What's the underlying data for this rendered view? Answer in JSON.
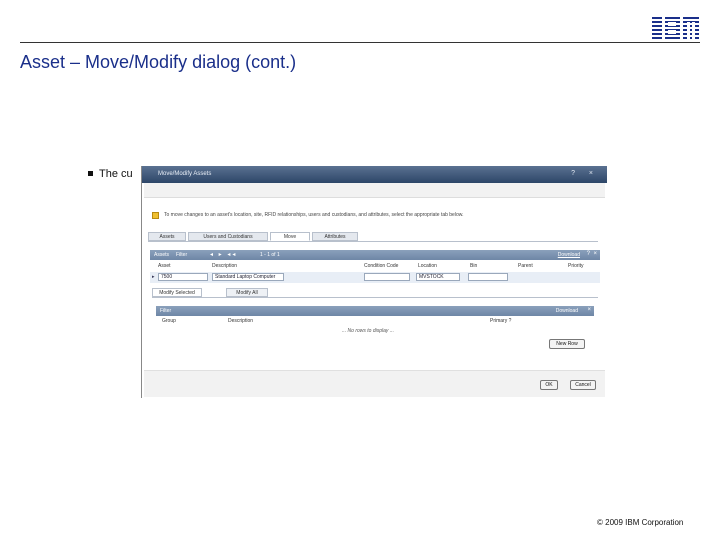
{
  "slide": {
    "title": "Asset – Move/Modify dialog (cont.)",
    "bullet": "The cu",
    "footer": "© 2009 IBM Corporation",
    "logo_text": "IBM",
    "brand_color": "#1a2f8a"
  },
  "dialog": {
    "title": "Move/Modify Assets",
    "header_icons": "? ×",
    "message": "To move changes to an asset's location, site, RFID relationships, users and custodians, and attributes, select the appropriate tab below.",
    "tabs": [
      {
        "label": "Assets"
      },
      {
        "label": "Users and Custodians"
      },
      {
        "label": "Move"
      },
      {
        "label": "Attributes"
      }
    ],
    "active_tab": "Move",
    "assets_table": {
      "label": "Assets",
      "filter_label": "Filter",
      "nav": "◂ ▸ ◂◂",
      "count": "1 - 1 of 1",
      "download_label": "Download",
      "help_icon": "?",
      "close_icon": "×",
      "columns": [
        "Asset",
        "Description",
        "Condition Code",
        "Location",
        "Bin",
        "Parent",
        "Priority"
      ],
      "rows": [
        {
          "asset": "7500",
          "description": "Standard Laptop Computer",
          "location": "MVSTOCK"
        }
      ]
    },
    "subtabs": [
      {
        "label": "Modify Selected"
      },
      {
        "label": "Modify All"
      }
    ],
    "sub_table": {
      "label": "Filter",
      "download_label": "Download",
      "columns": [
        "Group",
        "Description",
        "Primary ?"
      ],
      "empty_message": "... No rows to display ..."
    },
    "new_row_label": "New Row",
    "ok_label": "OK",
    "cancel_label": "Cancel"
  }
}
